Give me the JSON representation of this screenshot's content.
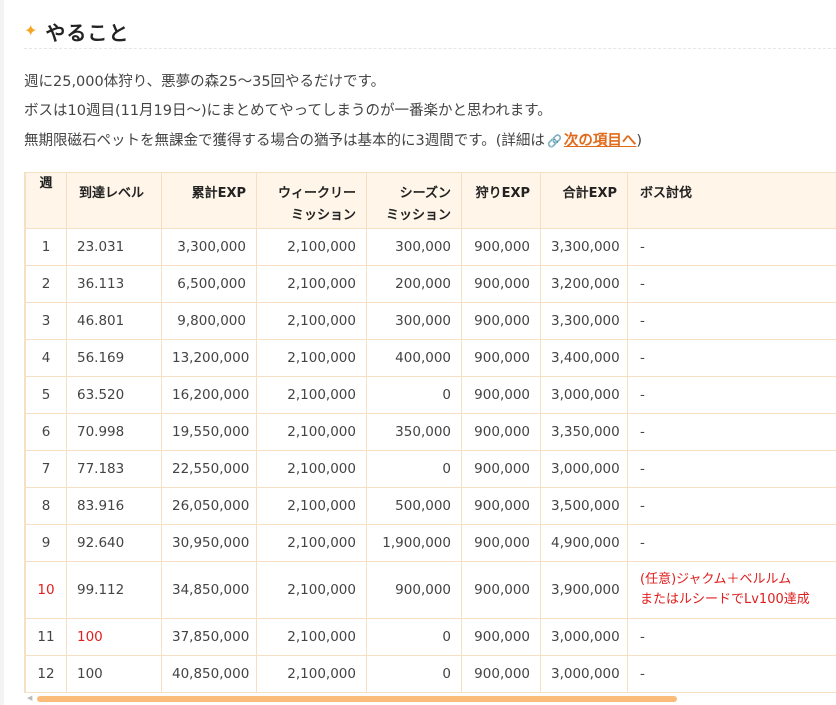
{
  "heading": {
    "icon": "sparkle-icon",
    "title": "やること"
  },
  "intro": {
    "line1": "週に25,000体狩り、悪夢の森25〜35回やるだけです。",
    "line2": "ボスは10週目(11月19日〜)にまとめてやってしまうのが一番楽かと思われます。",
    "line3_prefix": "無期限磁石ペットを無課金で獲得する場合の猶予は基本的に3週間です。(詳細は",
    "link_icon": "link-icon",
    "link_text": "次の項目へ",
    "line3_suffix": ")"
  },
  "table": {
    "headers": {
      "week": "週",
      "level": "到達レベル",
      "cumulative": "累計EXP",
      "weekly1": "ウィークリー",
      "weekly2": "ミッション",
      "season1": "シーズン",
      "season2": "ミッション",
      "hunt": "狩りEXP",
      "total": "合計EXP",
      "boss": "ボス討伐"
    },
    "rows": [
      {
        "week": "1",
        "level": "23.031",
        "cumulative": "3,300,000",
        "weekly": "2,100,000",
        "season": "300,000",
        "hunt": "900,000",
        "total": "3,300,000",
        "boss": "-"
      },
      {
        "week": "2",
        "level": "36.113",
        "cumulative": "6,500,000",
        "weekly": "2,100,000",
        "season": "200,000",
        "hunt": "900,000",
        "total": "3,200,000",
        "boss": "-"
      },
      {
        "week": "3",
        "level": "46.801",
        "cumulative": "9,800,000",
        "weekly": "2,100,000",
        "season": "300,000",
        "hunt": "900,000",
        "total": "3,300,000",
        "boss": "-"
      },
      {
        "week": "4",
        "level": "56.169",
        "cumulative": "13,200,000",
        "weekly": "2,100,000",
        "season": "400,000",
        "hunt": "900,000",
        "total": "3,400,000",
        "boss": "-"
      },
      {
        "week": "5",
        "level": "63.520",
        "cumulative": "16,200,000",
        "weekly": "2,100,000",
        "season": "0",
        "hunt": "900,000",
        "total": "3,000,000",
        "boss": "-"
      },
      {
        "week": "6",
        "level": "70.998",
        "cumulative": "19,550,000",
        "weekly": "2,100,000",
        "season": "350,000",
        "hunt": "900,000",
        "total": "3,350,000",
        "boss": "-"
      },
      {
        "week": "7",
        "level": "77.183",
        "cumulative": "22,550,000",
        "weekly": "2,100,000",
        "season": "0",
        "hunt": "900,000",
        "total": "3,000,000",
        "boss": "-"
      },
      {
        "week": "8",
        "level": "83.916",
        "cumulative": "26,050,000",
        "weekly": "2,100,000",
        "season": "500,000",
        "hunt": "900,000",
        "total": "3,500,000",
        "boss": "-"
      },
      {
        "week": "9",
        "level": "92.640",
        "cumulative": "30,950,000",
        "weekly": "2,100,000",
        "season": "1,900,000",
        "hunt": "900,000",
        "total": "4,900,000",
        "boss": "-"
      },
      {
        "week": "10",
        "level": "99.112",
        "cumulative": "34,850,000",
        "weekly": "2,100,000",
        "season": "900,000",
        "hunt": "900,000",
        "total": "3,900,000",
        "boss1": "(任意)ジャクム＋ベルルム",
        "boss2": "またはルシードでLv100達成"
      },
      {
        "week": "11",
        "level": "100",
        "cumulative": "37,850,000",
        "weekly": "2,100,000",
        "season": "0",
        "hunt": "900,000",
        "total": "3,000,000",
        "boss": "-"
      },
      {
        "week": "12",
        "level": "100",
        "cumulative": "40,850,000",
        "weekly": "2,100,000",
        "season": "0",
        "hunt": "900,000",
        "total": "3,000,000",
        "boss": "-"
      }
    ]
  },
  "colors": {
    "accent": "#e06a1a",
    "header_bg": "#fff5e9",
    "border": "#f6dfc2",
    "highlight": "#e02020",
    "scroll_thumb": "#fbbc7a"
  }
}
